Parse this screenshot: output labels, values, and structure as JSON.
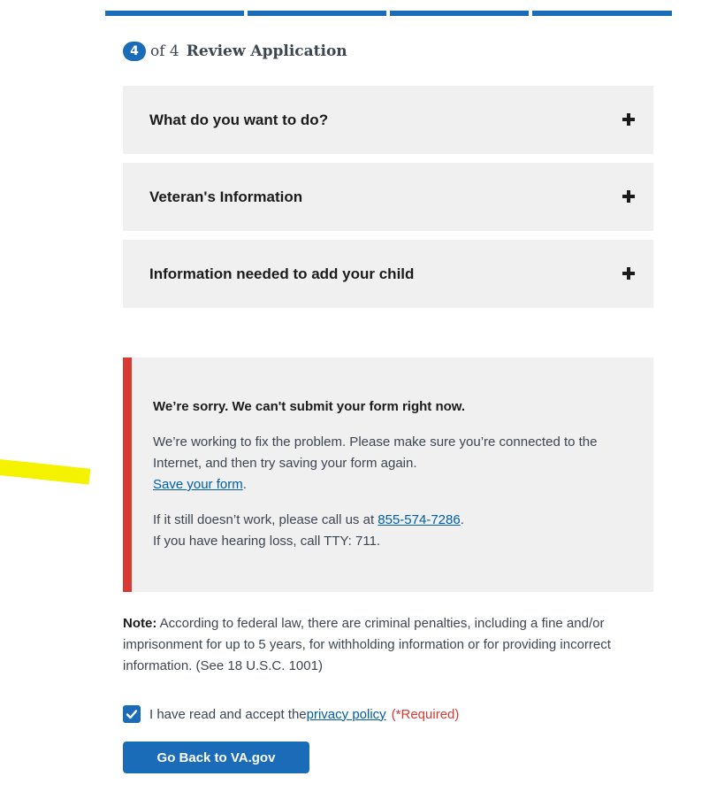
{
  "progress": {
    "current_step": 4,
    "total_steps": 4
  },
  "step_heading": {
    "number": "4",
    "of_text": "of 4",
    "title": "Review Application"
  },
  "accordions": [
    {
      "title": "What do you want to do?",
      "icon": "plus-icon"
    },
    {
      "title": "Veteran's Information",
      "icon": "plus-icon"
    },
    {
      "title": "Information needed to add your child",
      "icon": "plus-icon"
    }
  ],
  "alert": {
    "heading": "We’re sorry. We can't submit your form right now.",
    "body_text": "We’re working to fix the problem. Please make sure you’re connected to the Internet, and then try saving your form again.",
    "save_link": "Save your form",
    "save_suffix": ".",
    "call_prefix": "If it still doesn’t work, please call us at ",
    "phone": "855-574-7286",
    "call_suffix": ".",
    "tty_text": "If you have hearing loss, call TTY: 711."
  },
  "note": {
    "label": "Note:",
    "text": " According to federal law, there are criminal penalties, including a fine and/or imprisonment for up to 5 years, for withholding information or for providing incorrect information. (See 18 U.S.C. 1001)"
  },
  "consent": {
    "checked": true,
    "prefix": "I have read and accept the ",
    "link": "privacy policy",
    "required": "(*Required)"
  },
  "go_back_button": "Go Back to VA.gov",
  "colors": {
    "primary": "#1a6bb8",
    "error": "#d83933",
    "panel": "#f0f0f0",
    "highlight": "#f5f200"
  }
}
